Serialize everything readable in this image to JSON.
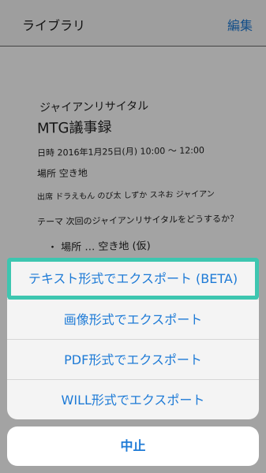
{
  "nav": {
    "title": "ライブラリ",
    "edit": "編集"
  },
  "note": {
    "title": "ジャイアンリサイタル",
    "subtitle": "MTG議事録",
    "date": "日時  2016年1月25日(月)  10:00 〜 12:00",
    "place": "場所  空き地",
    "attendees": "出席  ドラえもん  のび太  しずか  スネお  ジャイアン",
    "theme": "テーマ  次回のジャイアンリサイタルをどうするか？",
    "bullet": "・ 場所 … 空き地 (仮)"
  },
  "sheet": {
    "options": [
      "テキスト形式でエクスポート (BETA)",
      "画像形式でエクスポート",
      "PDF形式でエクスポート",
      "WILL形式でエクスポート"
    ],
    "cancel": "中止"
  },
  "colors": {
    "accent": "#1d7ad6",
    "highlight": "#3dc6b0"
  }
}
